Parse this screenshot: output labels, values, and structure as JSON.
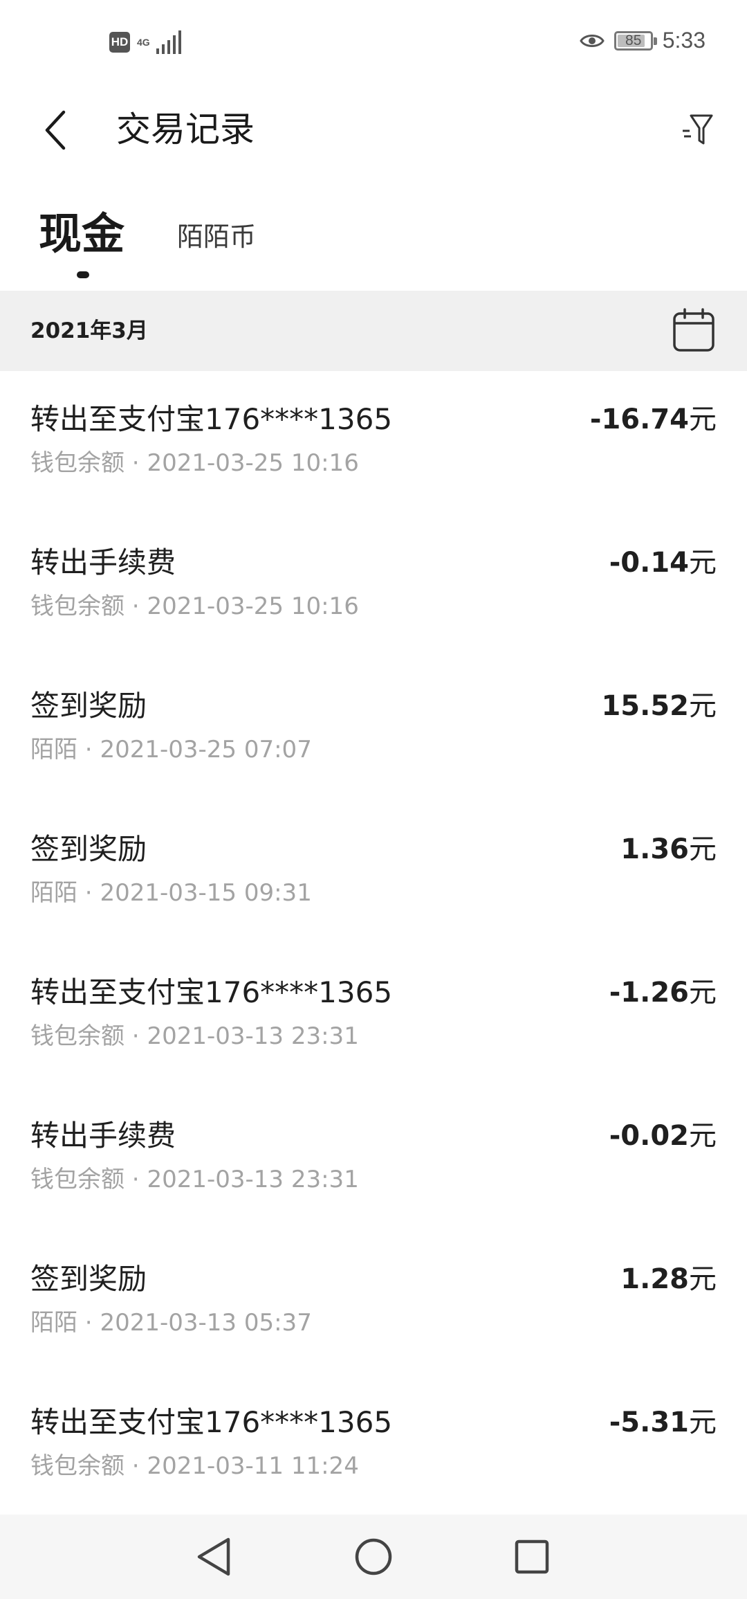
{
  "status_bar": {
    "hd": "HD",
    "network": "4G",
    "battery": "85",
    "battery_level": 0.85,
    "time": "5:33"
  },
  "header": {
    "title": "交易记录",
    "back_icon": "chevron-left-icon",
    "filter_icon": "filter-icon"
  },
  "tabs": {
    "cash": "现金",
    "coin": "陌陌币",
    "active": "cash"
  },
  "month": {
    "label": "2021年3月",
    "calendar_icon": "calendar-icon"
  },
  "transactions": [
    {
      "title": "转出至支付宝176****1365",
      "source": "钱包余额",
      "datetime": "2021-03-25 10:16",
      "amount": "-16.74",
      "unit": "元"
    },
    {
      "title": "转出手续费",
      "source": "钱包余额",
      "datetime": "2021-03-25 10:16",
      "amount": "-0.14",
      "unit": "元"
    },
    {
      "title": "签到奖励",
      "source": "陌陌",
      "datetime": "2021-03-25 07:07",
      "amount": "15.52",
      "unit": "元"
    },
    {
      "title": "签到奖励",
      "source": "陌陌",
      "datetime": "2021-03-15 09:31",
      "amount": "1.36",
      "unit": "元"
    },
    {
      "title": "转出至支付宝176****1365",
      "source": "钱包余额",
      "datetime": "2021-03-13 23:31",
      "amount": "-1.26",
      "unit": "元"
    },
    {
      "title": "转出手续费",
      "source": "钱包余额",
      "datetime": "2021-03-13 23:31",
      "amount": "-0.02",
      "unit": "元"
    },
    {
      "title": "签到奖励",
      "source": "陌陌",
      "datetime": "2021-03-13 05:37",
      "amount": "1.28",
      "unit": "元"
    },
    {
      "title": "转出至支付宝176****1365",
      "source": "钱包余额",
      "datetime": "2021-03-11 11:24",
      "amount": "-5.31",
      "unit": "元"
    }
  ],
  "separator": " · ",
  "nav_bar": {
    "back_icon": "triangle-back-icon",
    "home_icon": "circle-home-icon",
    "recent_icon": "square-recents-icon"
  }
}
